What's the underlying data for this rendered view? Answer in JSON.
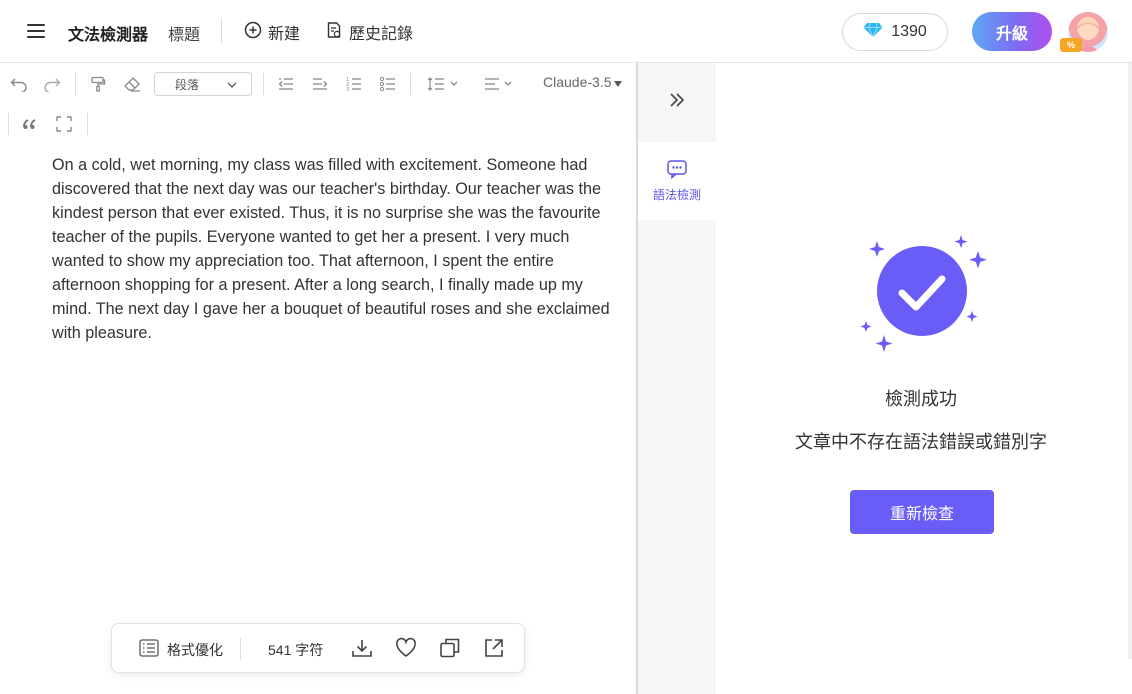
{
  "header": {
    "app_title": "文法檢測器",
    "doc_title": "標題",
    "new_label": "新建",
    "history_label": "歷史記錄",
    "credits": "1390",
    "upgrade_label": "升級",
    "badge": "%"
  },
  "toolbar": {
    "paragraph_select": "段落",
    "model": "Claude-3.5"
  },
  "editor": {
    "content": "On a cold, wet morning, my class was filled with excitement. Someone had discovered that the next day was our teacher's birthday. Our teacher was the kindest person that ever existed. Thus, it is no surprise she was the favourite teacher of the pupils. Everyone wanted to get her a present. I very much wanted to show my appreciation too. That afternoon, I spent the entire afternoon shopping for a present. After a long search, I finally made up my mind. The next day I gave her a bouquet of beautiful roses and she exclaimed with pleasure."
  },
  "bottom_bar": {
    "format_label": "格式優化",
    "char_count": "541 字符"
  },
  "sidebar": {
    "tab_label": "語法檢測"
  },
  "result": {
    "title": "檢測成功",
    "description": "文章中不存在語法錯誤或錯別字",
    "recheck_label": "重新檢查"
  },
  "colors": {
    "accent": "#6a5cf6",
    "diamond": "#29b6f6"
  }
}
